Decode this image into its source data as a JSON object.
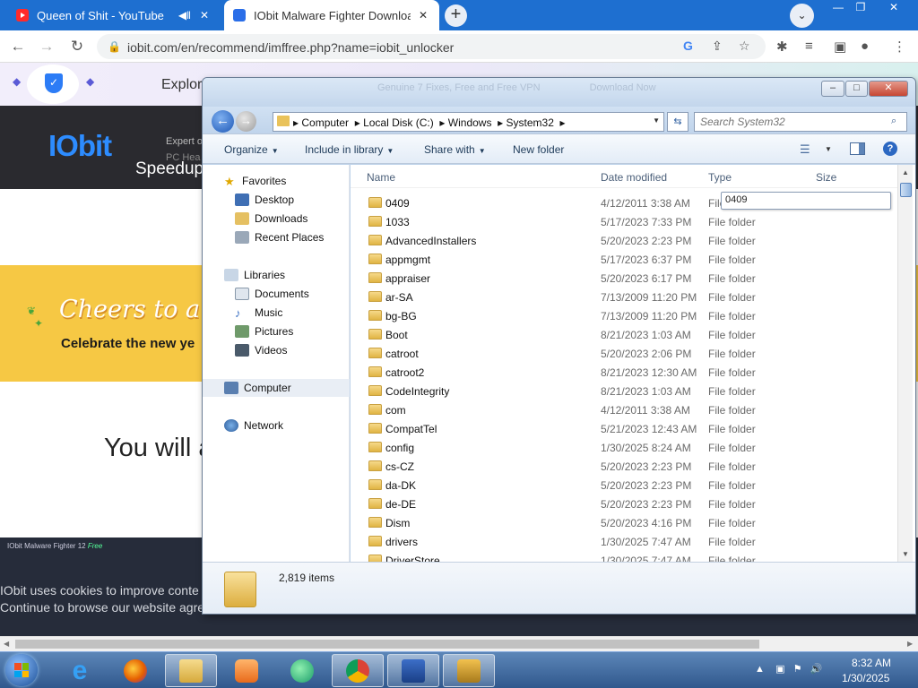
{
  "browser": {
    "tabs": [
      {
        "title": "Queen of Shit - YouTube",
        "active": false
      },
      {
        "title": "IObit Malware Fighter Downloa",
        "active": true
      }
    ],
    "url": "iobit.com/en/recommend/imffree.php?name=iobit_unlocker"
  },
  "webpage": {
    "nav_text": "Explor",
    "logo": "IObit",
    "hero_expert": "Expert o",
    "hero_pchealth": "PC Hea",
    "hero_speedup": "Speedup",
    "banner_title": "Cheers to a B",
    "banner_sub": "Celebrate the new ye",
    "you_will": "You will a",
    "footer_product": "IObit Malware Fighter 12",
    "footer_free": "Free",
    "cookie_line1": "IObit uses cookies to improve conte",
    "cookie_line2": "Continue to browse our website agre"
  },
  "explorer": {
    "ghost_title": "Genuine 7 Fixes, Free and Free VPN",
    "ghost_right": "Download Now",
    "address_parts": [
      "Computer",
      "Local Disk (C:)",
      "Windows",
      "System32"
    ],
    "search_placeholder": "Search System32",
    "commands": {
      "organize": "Organize",
      "include": "Include in library",
      "share": "Share with",
      "newfolder": "New folder"
    },
    "nav": {
      "favorites": "Favorites",
      "desktop": "Desktop",
      "downloads": "Downloads",
      "recent": "Recent Places",
      "libraries": "Libraries",
      "documents": "Documents",
      "music": "Music",
      "pictures": "Pictures",
      "videos": "Videos",
      "computer": "Computer",
      "network": "Network"
    },
    "columns": {
      "name": "Name",
      "date": "Date modified",
      "type": "Type",
      "size": "Size"
    },
    "rename_value": "0409",
    "rows": [
      {
        "name": "0409",
        "date": "4/12/2011 3:38 AM",
        "type": "File"
      },
      {
        "name": "1033",
        "date": "5/17/2023 7:33 PM",
        "type": "File folder"
      },
      {
        "name": "AdvancedInstallers",
        "date": "5/20/2023 2:23 PM",
        "type": "File folder"
      },
      {
        "name": "appmgmt",
        "date": "5/17/2023 6:37 PM",
        "type": "File folder"
      },
      {
        "name": "appraiser",
        "date": "5/20/2023 6:17 PM",
        "type": "File folder"
      },
      {
        "name": "ar-SA",
        "date": "7/13/2009 11:20 PM",
        "type": "File folder"
      },
      {
        "name": "bg-BG",
        "date": "7/13/2009 11:20 PM",
        "type": "File folder"
      },
      {
        "name": "Boot",
        "date": "8/21/2023 1:03 AM",
        "type": "File folder"
      },
      {
        "name": "catroot",
        "date": "5/20/2023 2:06 PM",
        "type": "File folder"
      },
      {
        "name": "catroot2",
        "date": "8/21/2023 12:30 AM",
        "type": "File folder"
      },
      {
        "name": "CodeIntegrity",
        "date": "8/21/2023 1:03 AM",
        "type": "File folder"
      },
      {
        "name": "com",
        "date": "4/12/2011 3:38 AM",
        "type": "File folder"
      },
      {
        "name": "CompatTel",
        "date": "5/21/2023 12:43 AM",
        "type": "File folder"
      },
      {
        "name": "config",
        "date": "1/30/2025 8:24 AM",
        "type": "File folder"
      },
      {
        "name": "cs-CZ",
        "date": "5/20/2023 2:23 PM",
        "type": "File folder"
      },
      {
        "name": "da-DK",
        "date": "5/20/2023 2:23 PM",
        "type": "File folder"
      },
      {
        "name": "de-DE",
        "date": "5/20/2023 2:23 PM",
        "type": "File folder"
      },
      {
        "name": "Dism",
        "date": "5/20/2023 4:16 PM",
        "type": "File folder"
      },
      {
        "name": "drivers",
        "date": "1/30/2025 7:47 AM",
        "type": "File folder"
      },
      {
        "name": "DriverStore",
        "date": "1/30/2025 7:47 AM",
        "type": "File folder"
      }
    ],
    "item_count": "2,819 items"
  },
  "taskbar": {
    "time": "8:32 AM",
    "date": "1/30/2025"
  },
  "colors": {
    "chrome_tabstrip": "#1e6fd0",
    "iobit_blue": "#2d8cff",
    "banner_yellow": "#f6c844",
    "taskbar": "#30588d"
  }
}
